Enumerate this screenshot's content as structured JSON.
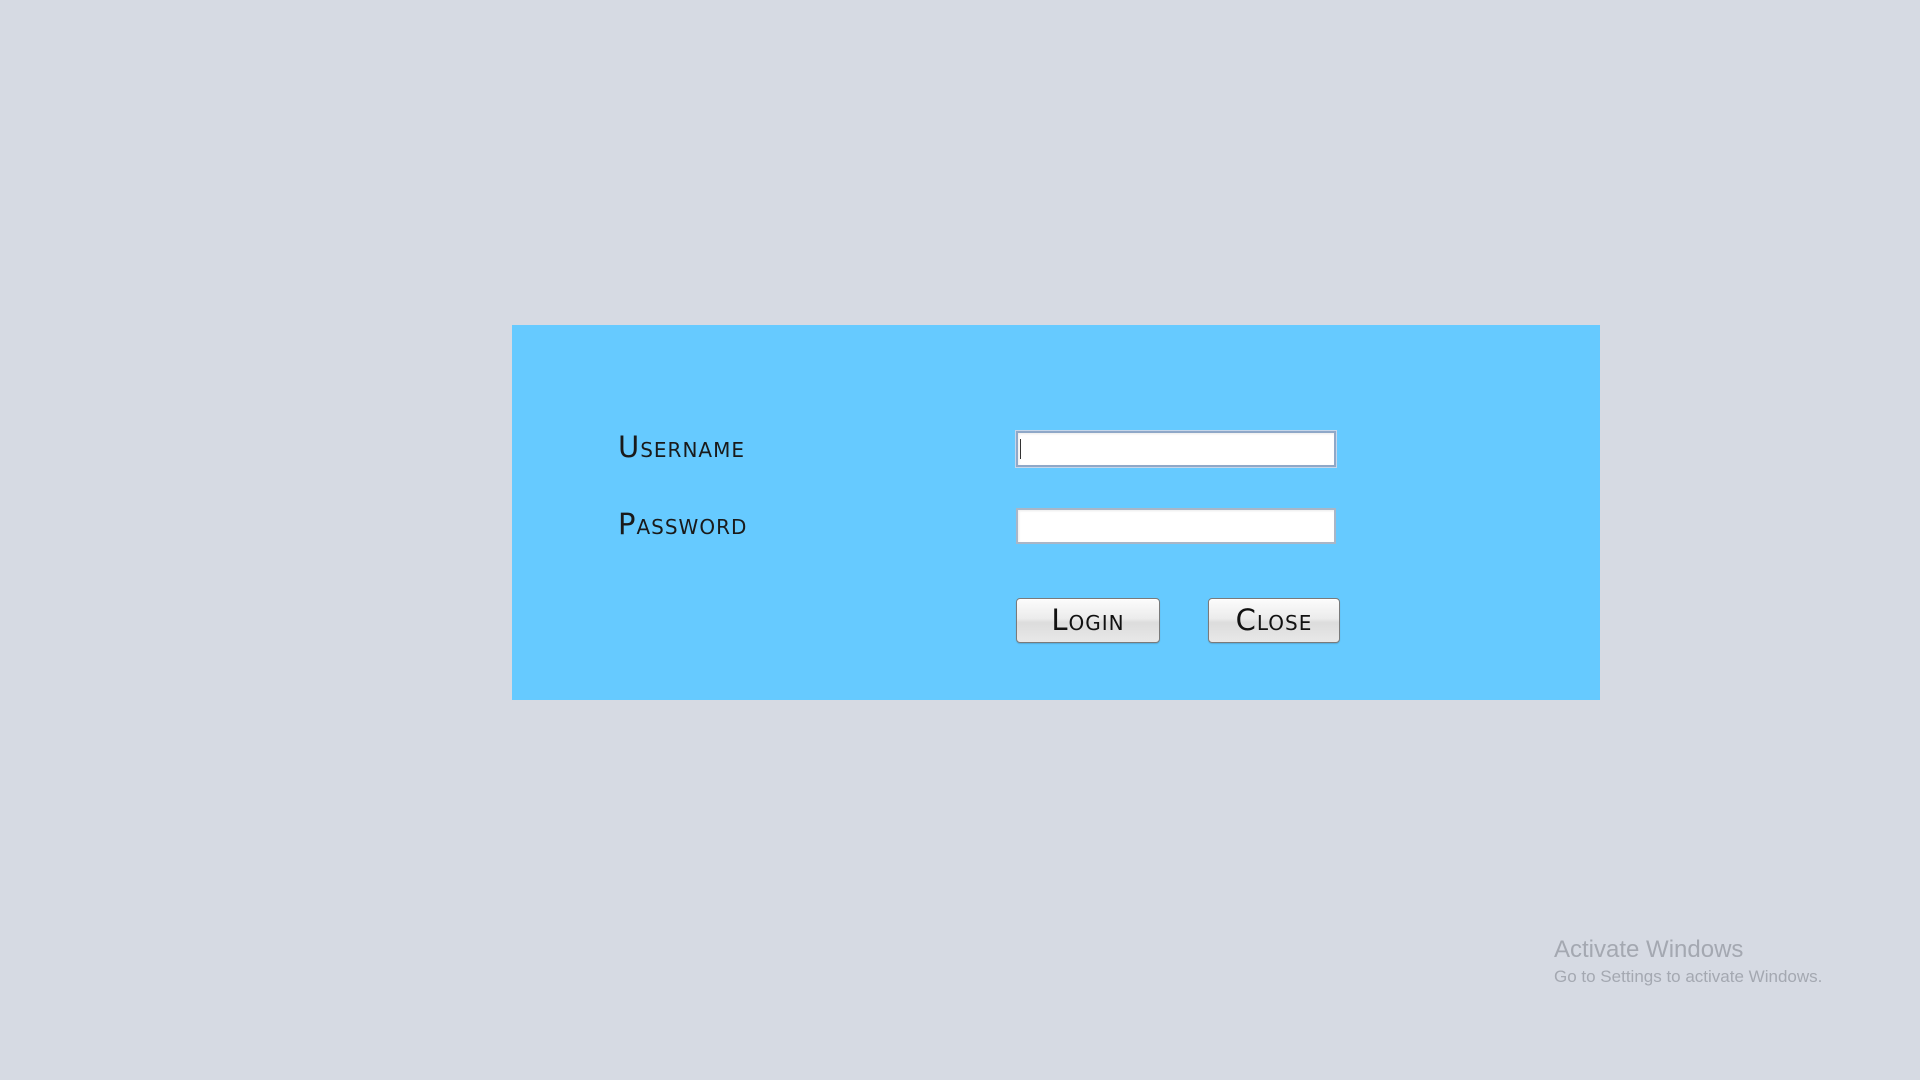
{
  "login": {
    "username_label": "Username",
    "password_label": "Password",
    "username_value": "",
    "password_value": "",
    "login_label": "Login",
    "close_label": "Close"
  },
  "watermark": {
    "title": "Activate Windows",
    "subtitle": "Go to Settings to activate Windows."
  },
  "colors": {
    "background": "#d6dae3",
    "panel": "#66caff"
  }
}
